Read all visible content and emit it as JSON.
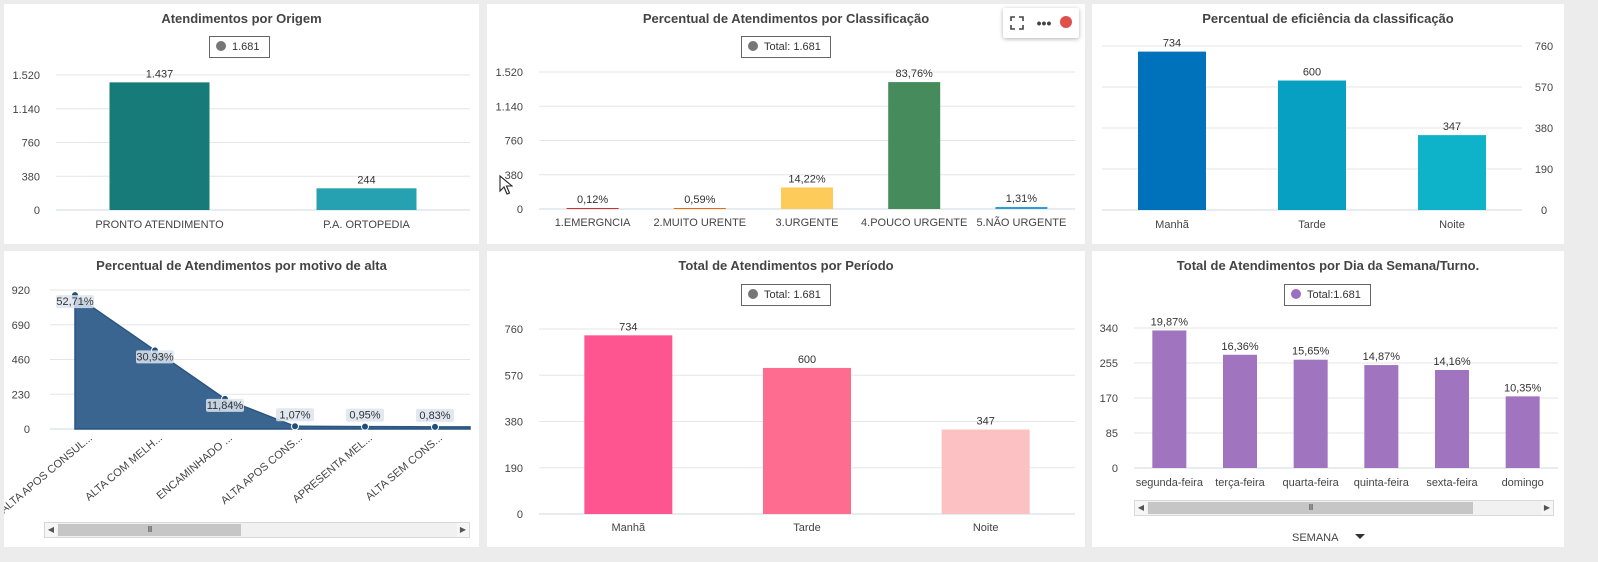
{
  "colors": {
    "background": "#ececec",
    "panel": "#ffffff",
    "grid": "#e6e6e6",
    "label": "#333333"
  },
  "chart_data": [
    {
      "type": "bar",
      "title": "Atendimentos por Origem",
      "legend": {
        "text": "1.681",
        "color": "#777777"
      },
      "categories": [
        "PRONTO ATENDIMENTO",
        "P.A. ORTOPEDIA"
      ],
      "values": [
        1437,
        244
      ],
      "value_labels": [
        "1.437",
        "244"
      ],
      "colors": [
        "#177b7a",
        "#25a1b2"
      ],
      "yticks": [
        0,
        380,
        760,
        1140,
        1520
      ],
      "ytick_labels": [
        "0",
        "380",
        "760",
        "1.140",
        "1.520"
      ],
      "ylim": [
        0,
        1520
      ],
      "grid": true
    },
    {
      "type": "bar",
      "title": "Percentual de Atendimentos por Classificação",
      "legend": {
        "text": "Total: 1.681",
        "color": "#777777"
      },
      "categories": [
        "1.EMERGNCIA",
        "2.MUITO URENTE",
        "3.URGENTE",
        "4.POUCO URGENTE",
        "5.NÃO URGENTE"
      ],
      "values": [
        2,
        10,
        239,
        1408,
        22
      ],
      "value_labels": [
        "0,12%",
        "0,59%",
        "14,22%",
        "83,76%",
        "1,31%"
      ],
      "colors": [
        "#d32f2f",
        "#ef6c00",
        "#fccb5a",
        "#458b5b",
        "#2e9ad6"
      ],
      "yticks": [
        0,
        380,
        760,
        1140,
        1520
      ],
      "ytick_labels": [
        "0",
        "380",
        "760",
        "1.140",
        "1.520"
      ],
      "ylim": [
        0,
        1520
      ],
      "grid": true
    },
    {
      "type": "bar",
      "title": "Percentual de eficiência da classificação",
      "categories": [
        "Manhã",
        "Tarde",
        "Noite"
      ],
      "values": [
        734,
        600,
        347
      ],
      "value_labels": [
        "734",
        "600",
        "347"
      ],
      "colors": [
        "#0072bb",
        "#07a0c3",
        "#0fb3c9"
      ],
      "yticks": [
        0,
        190,
        380,
        570,
        760
      ],
      "ytick_labels": [
        "0",
        "190",
        "380",
        "570",
        "760"
      ],
      "ylim": [
        0,
        760
      ],
      "yaxis_side": "right",
      "grid": true
    },
    {
      "type": "area",
      "title": "Percentual de Atendimentos por motivo de alta",
      "categories": [
        "ALTA APOS CONSUL...",
        "ALTA COM MELH...",
        "ENCAMINHADO ...",
        "ALTA APOS CONS...",
        "APRESENTA MEL...",
        "ALTA SEM CONS..."
      ],
      "values": [
        886,
        520,
        199,
        18,
        16,
        14
      ],
      "value_labels": [
        "52,71%",
        "30,93%",
        "11,84%",
        "1,07%",
        "0,95%",
        "0,83%"
      ],
      "color": "#3b6591",
      "yticks": [
        0,
        230,
        460,
        690,
        920
      ],
      "ytick_labels": [
        "0",
        "230",
        "460",
        "690",
        "920"
      ],
      "ylim": [
        0,
        920
      ],
      "grid": true
    },
    {
      "type": "bar",
      "title": "Total de Atendimentos por Período",
      "legend": {
        "text": "Total: 1.681",
        "color": "#777777"
      },
      "categories": [
        "Manhã",
        "Tarde",
        "Noite"
      ],
      "values": [
        734,
        600,
        347
      ],
      "value_labels": [
        "734",
        "600",
        "347"
      ],
      "colors": [
        "#fe5590",
        "#fe6c90",
        "#fbc1c3"
      ],
      "yticks": [
        0,
        190,
        380,
        570,
        760
      ],
      "ytick_labels": [
        "0",
        "190",
        "380",
        "570",
        "760"
      ],
      "ylim": [
        0,
        760
      ],
      "grid": true
    },
    {
      "type": "bar",
      "title": "Total de Atendimentos por Dia da Semana/Turno.",
      "legend": {
        "text": "Total:1.681",
        "color": "#9c6fc0"
      },
      "categories": [
        "segunda-feira",
        "terça-feira",
        "quarta-feira",
        "quinta-feira",
        "sexta-feira",
        "domingo"
      ],
      "values": [
        334,
        275,
        263,
        250,
        238,
        174
      ],
      "value_labels": [
        "19,87%",
        "16,36%",
        "15,65%",
        "14,87%",
        "14,16%",
        "10,35%"
      ],
      "colors": [
        "#a074bf",
        "#a074bf",
        "#a074bf",
        "#a074bf",
        "#a074bf",
        "#a074bf"
      ],
      "yticks": [
        0,
        85,
        170,
        255,
        340
      ],
      "ytick_labels": [
        "0",
        "85",
        "170",
        "255",
        "340"
      ],
      "ylim": [
        0,
        340
      ],
      "grid": true
    }
  ],
  "toolbar": {
    "expand_icon": "expand-icon",
    "more_icon": "more-options-icon",
    "record_icon": "record-dot-icon",
    "record_color": "#e0504a"
  },
  "scrollbar": {
    "grip": "III",
    "left_arrow": "◀",
    "right_arrow": "▶"
  },
  "field": {
    "label": "SEMANA",
    "dropdown_icon": "caret-down-icon"
  }
}
